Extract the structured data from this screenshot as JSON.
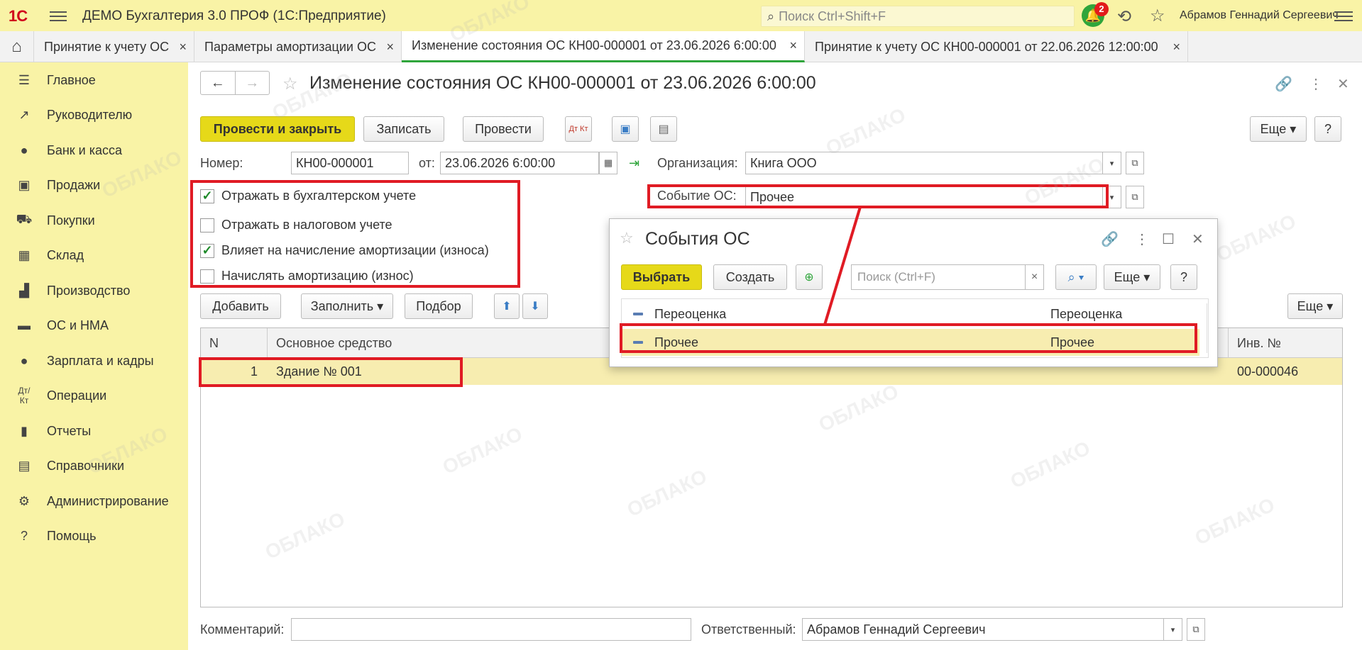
{
  "app": {
    "logo": "1С",
    "title": "ДЕМО Бухгалтерия 3.0 ПРОФ  (1С:Предприятие)",
    "search_placeholder": "Поиск Ctrl+Shift+F",
    "notifications_count": "2",
    "user": "Абрамов Геннадий Сергеевич"
  },
  "tabs": [
    {
      "label": "Принятие к учету ОС"
    },
    {
      "label": "Параметры амортизации ОС"
    },
    {
      "label": "Изменение состояния ОС КН00-000001 от 23.06.2026 6:00:00"
    },
    {
      "label": "Принятие к учету ОС КН00-000001 от 22.06.2026 12:00:00"
    }
  ],
  "sidebar": {
    "items": [
      {
        "label": "Главное",
        "icon": "menu-icon"
      },
      {
        "label": "Руководителю",
        "icon": "trend-icon"
      },
      {
        "label": "Банк и касса",
        "icon": "coin-icon"
      },
      {
        "label": "Продажи",
        "icon": "bag-icon"
      },
      {
        "label": "Покупки",
        "icon": "cart-icon"
      },
      {
        "label": "Склад",
        "icon": "warehouse-icon"
      },
      {
        "label": "Производство",
        "icon": "factory-icon"
      },
      {
        "label": "ОС и НМА",
        "icon": "truck-icon"
      },
      {
        "label": "Зарплата и кадры",
        "icon": "person-icon"
      },
      {
        "label": "Операции",
        "icon": "dt-kt-icon"
      },
      {
        "label": "Отчеты",
        "icon": "bar-chart-icon"
      },
      {
        "label": "Справочники",
        "icon": "book-icon"
      },
      {
        "label": "Администрирование",
        "icon": "gear-icon"
      },
      {
        "label": "Помощь",
        "icon": "help-icon"
      }
    ]
  },
  "form": {
    "title": "Изменение состояния ОС КН00-000001 от 23.06.2026 6:00:00",
    "toolbar": {
      "post_close": "Провести и закрыть",
      "save": "Записать",
      "post": "Провести",
      "more": "Еще",
      "help": "?"
    },
    "number_label": "Номер:",
    "number_value": "КН00-000001",
    "date_label": "от:",
    "date_value": "23.06.2026  6:00:00",
    "org_label": "Организация:",
    "org_value": "Книга ООО",
    "event_label": "Событие ОС:",
    "event_value": "Прочее",
    "checkboxes": [
      {
        "label": "Отражать в бухгалтерском учете",
        "checked": true
      },
      {
        "label": "Отражать в налоговом учете",
        "checked": false
      },
      {
        "label": "Влияет на начисление амортизации (износа)",
        "checked": true
      },
      {
        "label": "Начислять амортизацию (износ)",
        "checked": false
      }
    ],
    "table_toolbar": {
      "add": "Добавить",
      "fill": "Заполнить",
      "select": "Подбор",
      "more": "Еще"
    },
    "table": {
      "headers": {
        "n": "N",
        "asset": "Основное средство",
        "inv": "Инв. №"
      },
      "rows": [
        {
          "n": "1",
          "asset": "Здание № 001",
          "inv": "00-000046"
        }
      ]
    },
    "comment_label": "Комментарий:",
    "comment_value": "",
    "responsible_label": "Ответственный:",
    "responsible_value": "Абрамов Геннадий Сергеевич"
  },
  "popup": {
    "title": "События ОС",
    "select": "Выбрать",
    "create": "Создать",
    "search_placeholder": "Поиск (Ctrl+F)",
    "more": "Еще",
    "help": "?",
    "rows": [
      {
        "name": "Переоценка",
        "type": "Переоценка"
      },
      {
        "name": "Прочее",
        "type": "Прочее"
      }
    ]
  },
  "watermark": "ОБЛАКО"
}
